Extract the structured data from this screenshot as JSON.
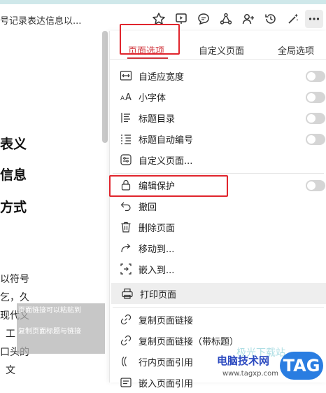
{
  "document": {
    "title_fragment": "号记录表达信息以...",
    "headings": [
      "表义",
      "信息",
      "方式"
    ],
    "text_lines": [
      "以符号",
      "乞，久",
      "现代文",
      "工",
      "口头的",
      "文"
    ]
  },
  "tooltip": {
    "line1": "页面链接可以粘贴到",
    "line2": "复制页面标题与链接"
  },
  "panel": {
    "tabs": [
      {
        "label": "页面选项",
        "active": true
      },
      {
        "label": "自定义页面",
        "active": false
      },
      {
        "label": "全局选项",
        "active": false
      }
    ],
    "options": [
      {
        "label": "自适应宽度",
        "icon": "fit-width-icon",
        "toggle": false
      },
      {
        "label": "小字体",
        "icon": "font-size-icon",
        "toggle": false
      },
      {
        "label": "标题目录",
        "icon": "toc-icon",
        "toggle": false
      },
      {
        "label": "标题自动编号",
        "icon": "numbered-list-icon",
        "toggle": false
      },
      {
        "label": "自定义页面...",
        "icon": "customize-icon"
      }
    ],
    "actions": [
      {
        "label": "编辑保护",
        "icon": "lock-icon",
        "toggle": false
      },
      {
        "label": "撤回",
        "icon": "undo-icon"
      },
      {
        "label": "删除页面",
        "icon": "trash-icon"
      },
      {
        "label": "移动到...",
        "icon": "move-icon"
      },
      {
        "label": "嵌入到...",
        "icon": "embed-icon"
      }
    ],
    "print": {
      "label": "打印页面",
      "icon": "printer-icon"
    },
    "links": [
      {
        "label": "复制页面链接",
        "icon": "link-icon"
      },
      {
        "label": "复制页面链接（带标题）",
        "icon": "link-icon"
      },
      {
        "label": "行内页面引用",
        "icon": "inline-ref-icon"
      },
      {
        "label": "嵌入页面引用",
        "icon": "embed-ref-icon"
      }
    ]
  },
  "watermark": {
    "brand": "电脑技术网",
    "logo": "TAG",
    "url": "www.tagxp.com",
    "faint": "极光下载站"
  },
  "colors": {
    "accent": "#d0343b",
    "highlight_box": "#e0252d"
  }
}
